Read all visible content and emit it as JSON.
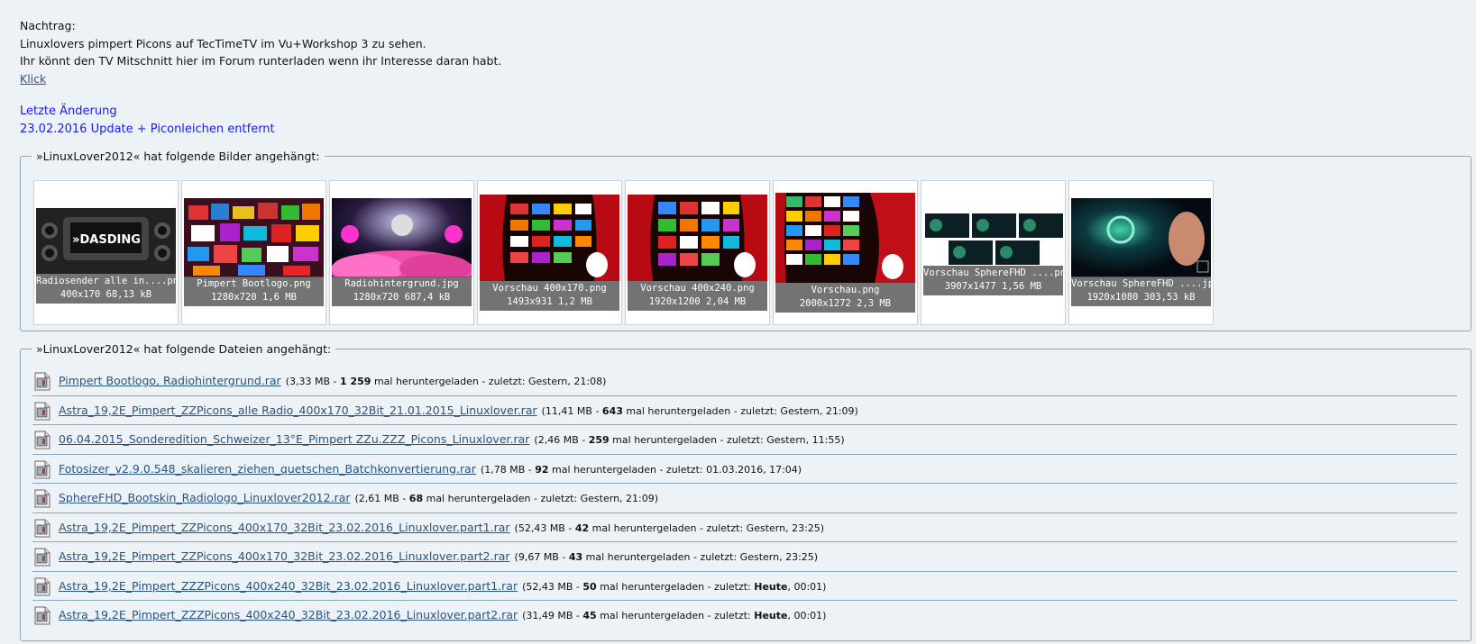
{
  "post": {
    "lines": [
      "Nachtrag:",
      "Linuxlovers pimpert Picons auf TecTimeTV im Vu+Workshop 3 zu sehen.",
      "Ihr könnt den TV Mitschnitt hier im Forum runterladen wenn ihr Interesse daran habt."
    ],
    "link": "Klick",
    "update_title": "Letzte Änderung",
    "update_text": "23.02.2016 Update + Piconleichen entfernt"
  },
  "images_section": {
    "legend": "»LinuxLover2012« hat folgende Bilder angehängt:",
    "items": [
      {
        "name": "Radiosender alle in....png",
        "info": "400x170 68,13 kB"
      },
      {
        "name": "Pimpert Bootlogo.png",
        "info": "1280x720 1,6 MB"
      },
      {
        "name": "Radiohintergrund.jpg",
        "info": "1280x720 687,4 kB"
      },
      {
        "name": "Vorschau 400x170.png",
        "info": "1493x931 1,2 MB"
      },
      {
        "name": "Vorschau 400x240.png",
        "info": "1920x1200 2,04 MB"
      },
      {
        "name": "Vorschau.png",
        "info": "2000x1272 2,3 MB"
      },
      {
        "name": "Vorschau SphereFHD ....png",
        "info": "3907x1477 1,56 MB"
      },
      {
        "name": "Vorschau SphereFHD ....jpg",
        "info": "1920x1080 303,53 kB"
      }
    ],
    "logo_text": "»DASDING"
  },
  "files_section": {
    "legend": "»LinuxLover2012« hat folgende Dateien angehängt:",
    "mid_text": " mal heruntergeladen - zuletzt: ",
    "items": [
      {
        "name": "Pimpert Bootlogo, Radiohintergrund.rar",
        "size": "3,33 MB",
        "count": "1 259",
        "when_bold": "",
        "when": "Gestern, 21:08"
      },
      {
        "name": "Astra_19,2E_Pimpert_ZZPicons_alle Radio_400x170_32Bit_21.01.2015_Linuxlover.rar",
        "size": "11,41 MB",
        "count": "643",
        "when_bold": "",
        "when": "Gestern, 21:09"
      },
      {
        "name": "06.04.2015_Sonderedition_Schweizer_13°E_Pimpert ZZu.ZZZ_Picons_Linuxlover.rar",
        "size": "2,46 MB",
        "count": "259",
        "when_bold": "",
        "when": "Gestern, 11:55"
      },
      {
        "name": "Fotosizer_v2.9.0.548_skalieren_ziehen_quetschen_Batchkonvertierung.rar",
        "size": "1,78 MB",
        "count": "92",
        "when_bold": "",
        "when": "01.03.2016, 17:04"
      },
      {
        "name": "SphereFHD_Bootskin_Radiologo_Linuxlover2012.rar",
        "size": "2,61 MB",
        "count": "68",
        "when_bold": "",
        "when": "Gestern, 21:09"
      },
      {
        "name": "Astra_19,2E_Pimpert_ZZPicons_400x170_32Bit_23.02.2016_Linuxlover.part1.rar",
        "size": "52,43 MB",
        "count": "42",
        "when_bold": "",
        "when": "Gestern, 23:25"
      },
      {
        "name": "Astra_19,2E_Pimpert_ZZPicons_400x170_32Bit_23.02.2016_Linuxlover.part2.rar",
        "size": "9,67 MB",
        "count": "43",
        "when_bold": "",
        "when": "Gestern, 23:25"
      },
      {
        "name": "Astra_19,2E_Pimpert_ZZZPicons_400x240_32Bit_23.02.2016_Linuxlover.part1.rar",
        "size": "52,43 MB",
        "count": "50",
        "when_bold": "Heute",
        "when": ", 00:01"
      },
      {
        "name": "Astra_19,2E_Pimpert_ZZZPicons_400x240_32Bit_23.02.2016_Linuxlover.part2.rar",
        "size": "31,49 MB",
        "count": "45",
        "when_bold": "Heute",
        "when": ", 00:01"
      }
    ]
  }
}
